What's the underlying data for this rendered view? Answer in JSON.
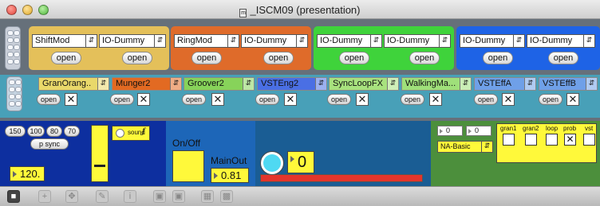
{
  "window": {
    "title": "_ISCM09 (presentation)"
  },
  "top_row": [
    {
      "menu1": "ShiftMod",
      "menu2": "IO-Dummy",
      "open1": "open",
      "open2": "open",
      "color": "#e4c05a"
    },
    {
      "menu1": "RingMod",
      "menu2": "IO-Dummy",
      "open1": "open",
      "open2": "open",
      "color": "#df6b2a"
    },
    {
      "menu1": "IO-Dummy",
      "menu2": "IO-Dummy",
      "open1": "open",
      "open2": "open",
      "color": "#3fd33b"
    },
    {
      "menu1": "IO-Dummy",
      "menu2": "IO-Dummy",
      "open1": "open",
      "open2": "open",
      "color": "#1e63e6"
    }
  ],
  "effects": [
    {
      "label": "GranOrang..",
      "open": "open",
      "checked": true,
      "color": "#e9d86a"
    },
    {
      "label": "Munger2",
      "open": "open",
      "checked": true,
      "color": "#e26a22"
    },
    {
      "label": "Groover2",
      "open": "open",
      "checked": true,
      "color": "#87d35a"
    },
    {
      "label": "VSTEng2",
      "open": "open",
      "checked": true,
      "color": "#4a6fe4"
    },
    {
      "label": "SyncLoopFX",
      "open": "open",
      "checked": true,
      "color": "#a8e27e"
    },
    {
      "label": "WalkingMa...",
      "open": "open",
      "checked": true,
      "color": "#9fe07a"
    },
    {
      "label": "VSTEffA",
      "open": "open",
      "checked": true,
      "color": "#6fa0e8"
    },
    {
      "label": "VSTEffB",
      "open": "open",
      "checked": true,
      "color": "#6fa0e8"
    }
  ],
  "tempo": {
    "buttons": [
      "150",
      "100",
      "80",
      "70"
    ],
    "psync": "p sync",
    "value": "120.",
    "sound_toggle": "sound",
    "sound_symbol": "ƒ",
    "fader_level": 0.2
  },
  "output": {
    "onoff_label": "On/Off",
    "mainout_label": "MainOut",
    "mainout_value": "0.81",
    "counter_value": "0",
    "meter_level": 1.0
  },
  "control": {
    "num1": "0",
    "num2": "0",
    "preset": "NA-Basic",
    "toggles": [
      {
        "label": "gran1",
        "checked": false
      },
      {
        "label": "gran2",
        "checked": false
      },
      {
        "label": "loop",
        "checked": false
      },
      {
        "label": "prob",
        "checked": true
      },
      {
        "label": "vst",
        "checked": false
      }
    ]
  },
  "toolbar": {
    "lock": "lock-icon",
    "icons": [
      "add-icon",
      "move-icon",
      "wand-icon",
      "info-icon",
      "layout-icon",
      "layout2-icon",
      "grid-icon",
      "grid2-icon"
    ]
  }
}
